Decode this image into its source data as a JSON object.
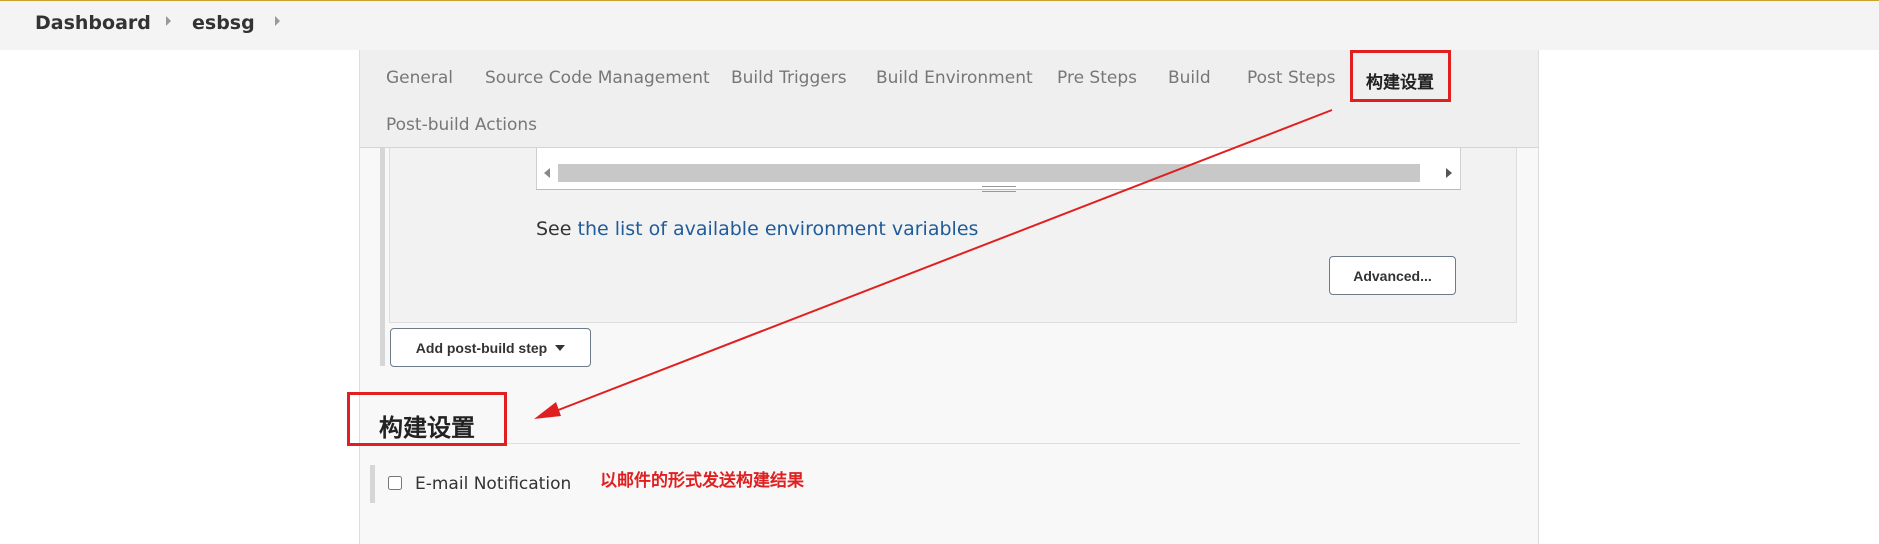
{
  "breadcrumb": {
    "items": [
      "Dashboard",
      "esbsg"
    ]
  },
  "tabs": [
    {
      "label": "General",
      "active": false
    },
    {
      "label": "Source Code Management",
      "active": false
    },
    {
      "label": "Build Triggers",
      "active": false
    },
    {
      "label": "Build Environment",
      "active": false
    },
    {
      "label": "Pre Steps",
      "active": false
    },
    {
      "label": "Build",
      "active": false
    },
    {
      "label": "Post Steps",
      "active": false
    },
    {
      "label": "构建设置",
      "active": true
    },
    {
      "label": "Post-build Actions",
      "active": false
    }
  ],
  "env_vars": {
    "prefix": "See",
    "link": "the list of available environment variables"
  },
  "buttons": {
    "advanced": "Advanced...",
    "add_post_build_step": "Add post-build step"
  },
  "section": {
    "title": "构建设置"
  },
  "email": {
    "label": "E-mail Notification",
    "checked": false
  },
  "annotation": {
    "note": "以邮件的形式发送构建结果",
    "color": "#e02020"
  },
  "colors": {
    "link": "#1f5c99",
    "annotation_red": "#e02020"
  }
}
